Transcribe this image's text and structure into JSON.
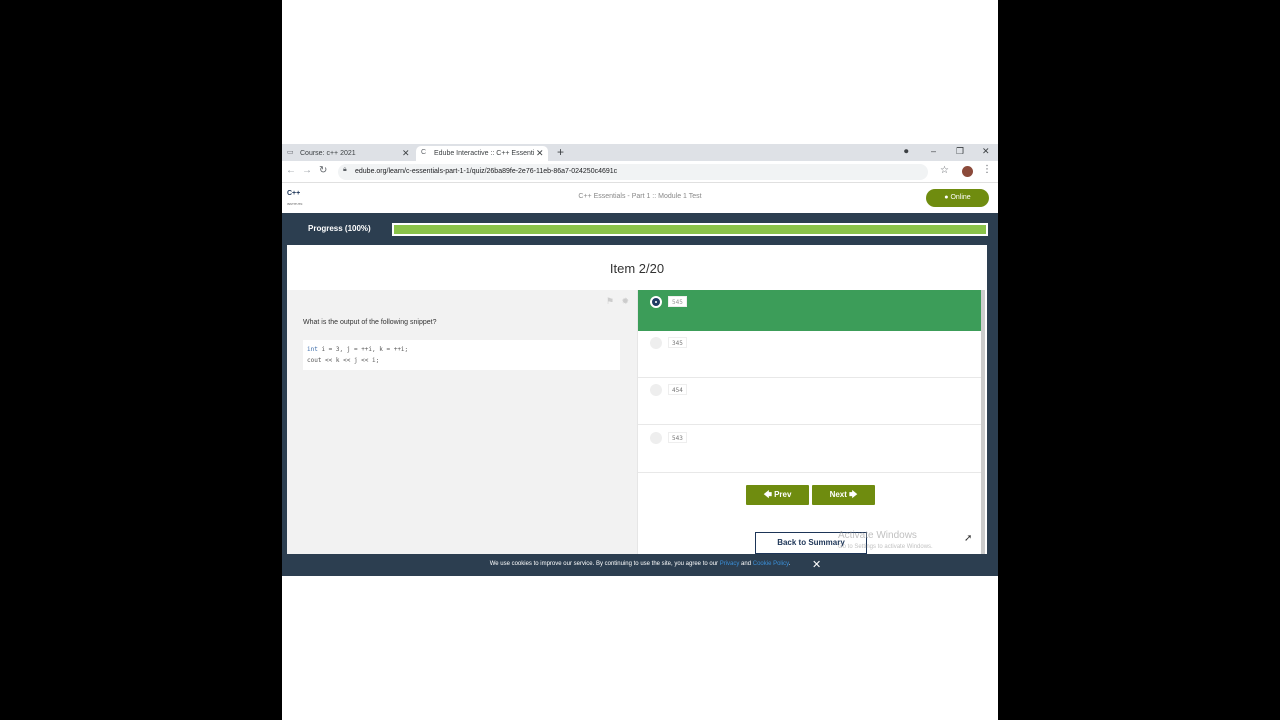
{
  "browser": {
    "tabs": [
      {
        "title": "Course: c++ 2021",
        "active": false
      },
      {
        "title": "Edube Interactive :: C++ Essenti",
        "active": true
      }
    ],
    "new_tab_label": "+",
    "url": "edube.org/learn/c-essentials-part-1-1/quiz/26ba89fe-2e76-11eb-86a7-024250c4691c",
    "window_controls": {
      "minimize": "–",
      "restore": "❐",
      "close": "✕"
    }
  },
  "site": {
    "logo_text": "C++",
    "logo_subtext": "INSTITUTE",
    "title": "C++ Essentials - Part 1 :: Module 1 Test",
    "status": "Online"
  },
  "progress": {
    "label": "Progress (100%)",
    "value": 100
  },
  "quiz": {
    "item_title": "Item 2/20",
    "question": "What is the output of the following snippet?",
    "code_lines": [
      {
        "kw": "int",
        "rest": " i = 3, j = ++i, k = ++i;"
      },
      {
        "kw": "",
        "rest": "cout << k << j << i;"
      }
    ],
    "options": [
      {
        "label": "545",
        "selected": true
      },
      {
        "label": "345",
        "selected": false
      },
      {
        "label": "454",
        "selected": false
      },
      {
        "label": "543",
        "selected": false
      }
    ],
    "prev_label": "🡄 Prev",
    "next_label": "Next 🡆",
    "summary_label": "Back to Summary"
  },
  "os_watermark": {
    "title": "Activate Windows",
    "subtitle": "Go to Settings to activate Windows."
  },
  "cookie": {
    "text": "We use cookies to improve our service. By continuing to use the site, you agree to our",
    "privacy_link": "Privacy",
    "and": "and",
    "cookie_link": "Cookie Policy",
    "suffix": ".",
    "close": "✕"
  },
  "colors": {
    "accent_green": "#6f8c0f",
    "selected_option": "#3c9d59",
    "progress_fill": "#8bc34a",
    "dark_bg": "#2c3e50"
  }
}
